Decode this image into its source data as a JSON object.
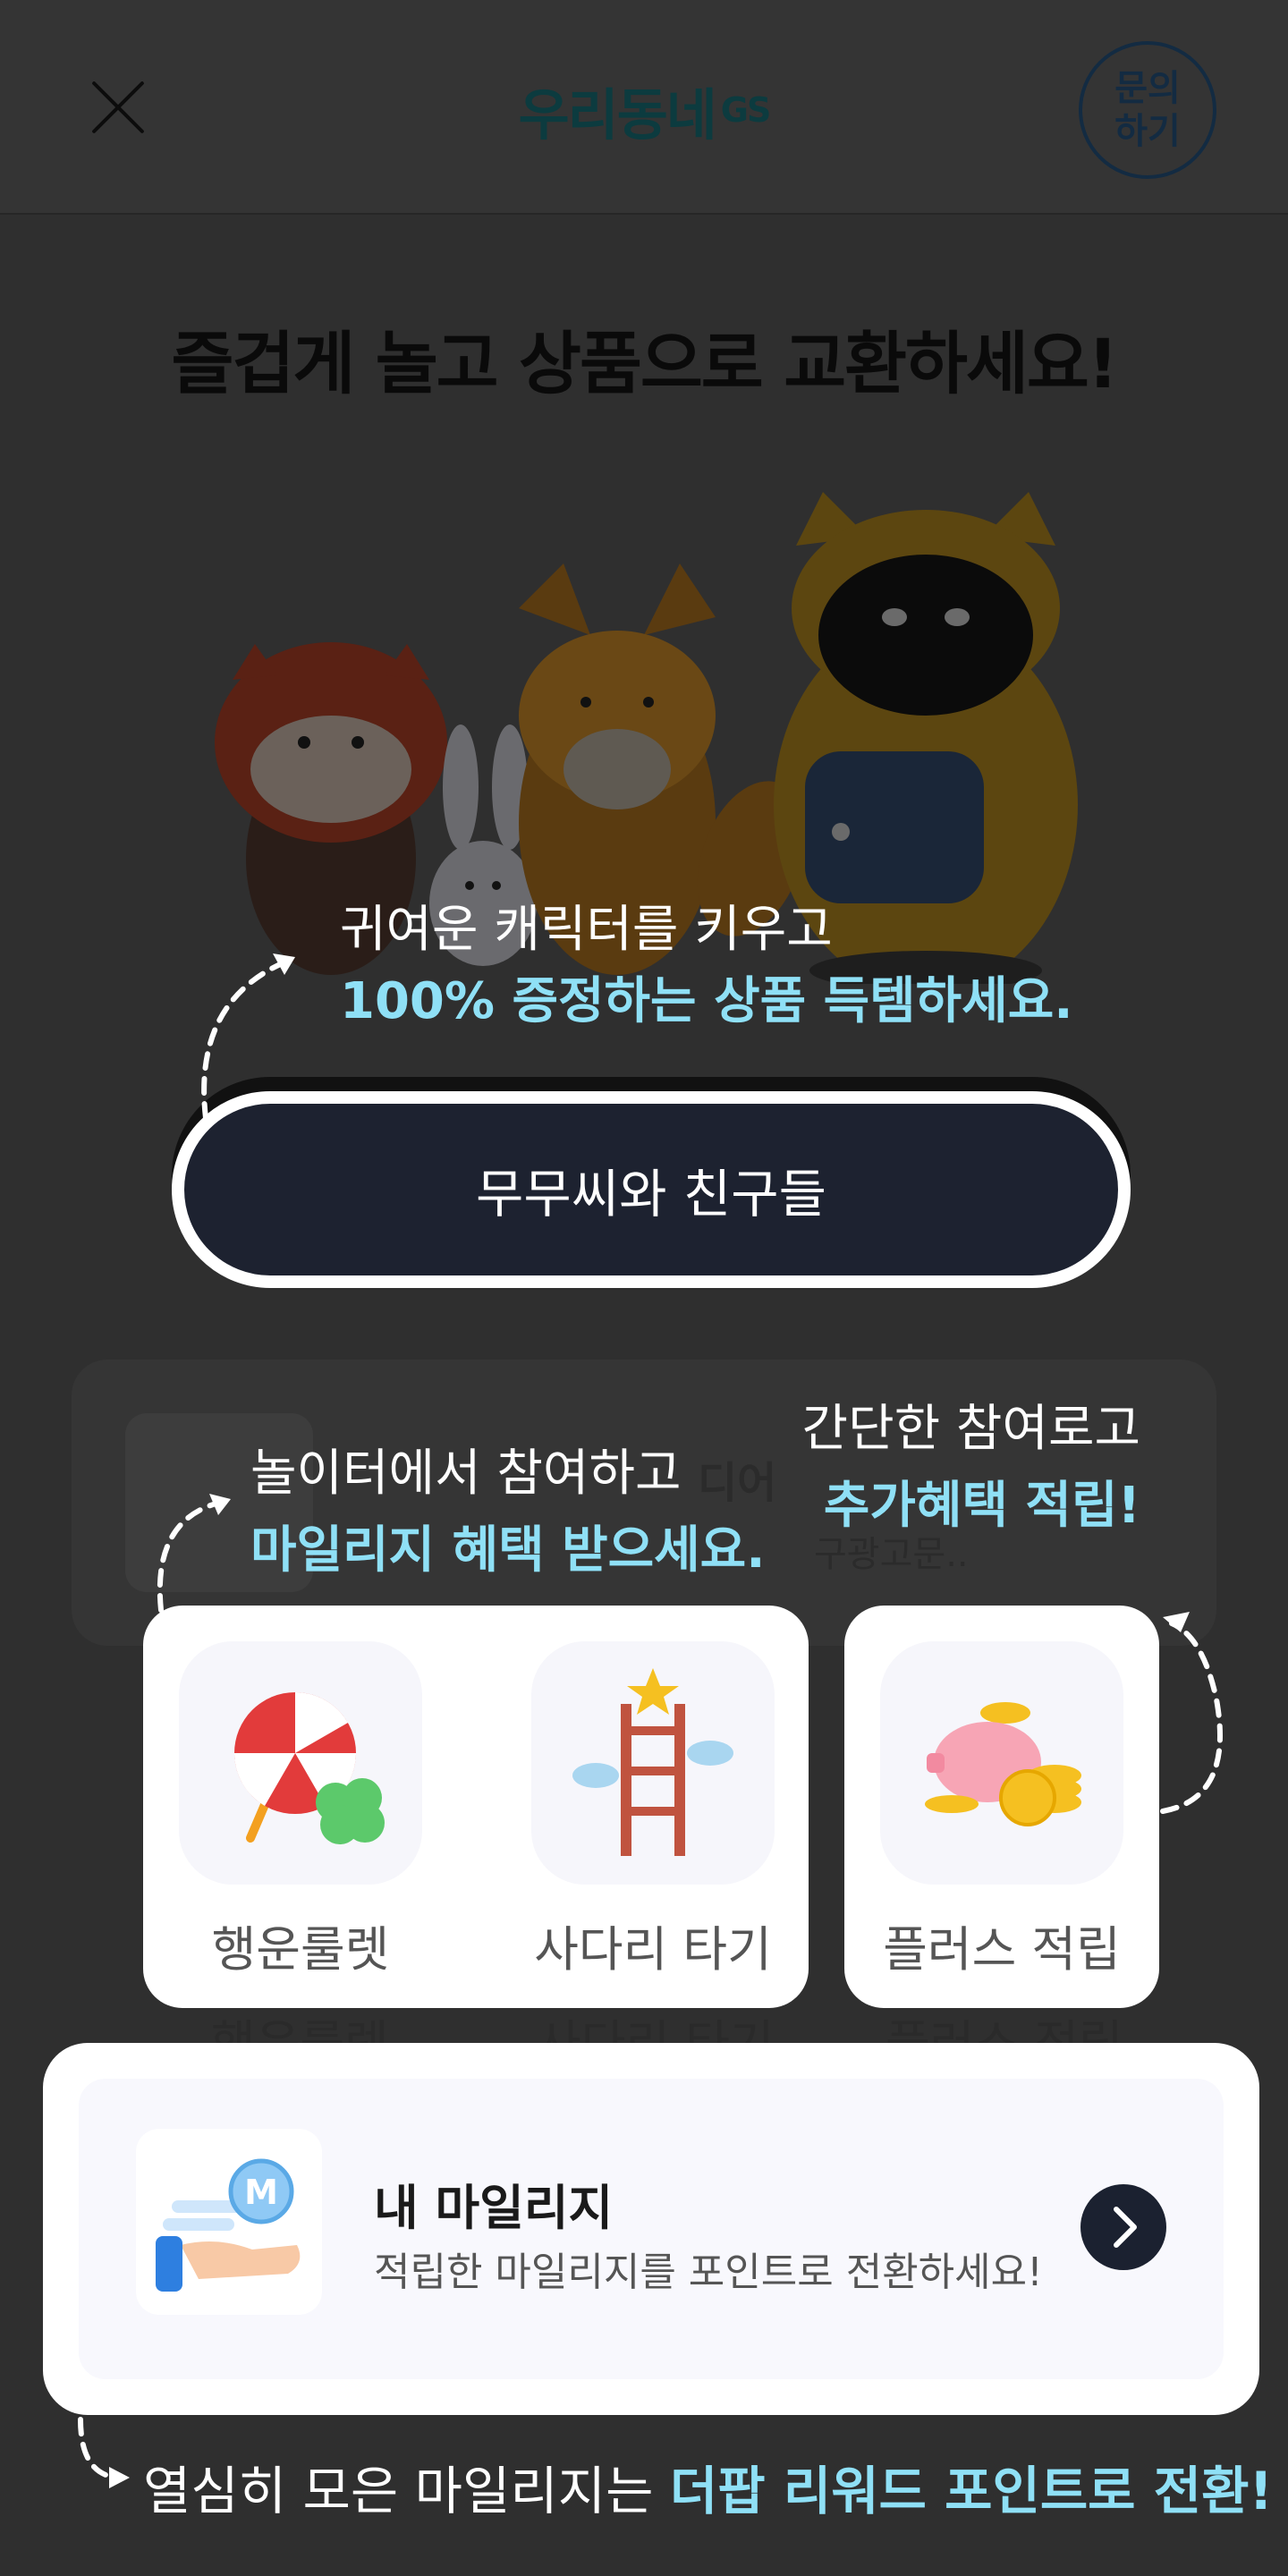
{
  "header": {
    "logo_text": "우리동네",
    "logo_suffix": "GS",
    "inquiry_label_1": "문의",
    "inquiry_label_2": "하기"
  },
  "hero": {
    "headline": "즐겁게 놀고 상품으로 교환하세요!",
    "caption_line1": "귀여운 캐릭터를 키우고",
    "caption_line2": "100% 증정하는 상품 득템하세요.",
    "cta_label": "무무씨와 친구들"
  },
  "playground": {
    "caption_left_line1": "놀이터에서 참여하고",
    "caption_left_line2": "마일리지 혜택 받으세요.",
    "caption_right_line1": "간단한 참여로고",
    "caption_right_line2": "추가혜택 적립!",
    "bg_title": "디어",
    "bg_sub": "구광고문..",
    "games": [
      {
        "label": "행운룰렛",
        "icon": "roulette-icon"
      },
      {
        "label": "사다리 타기",
        "icon": "ladder-icon"
      },
      {
        "label": "플러스 적립",
        "icon": "piggy-bank-icon"
      }
    ]
  },
  "mileage": {
    "title": "내 마일리지",
    "subtitle": "적립한 마일리지를 포인트로 전환하세요!",
    "badge_letter": "M"
  },
  "bottom": {
    "text_prefix": "열심히 모은 마일리지는 ",
    "text_highlight": "더팝 리워드 포인트로 전환!"
  },
  "colors": {
    "highlight": "#8fe0f6",
    "cta_bg": "#1d2230",
    "overlay": "#2f2f2f"
  }
}
